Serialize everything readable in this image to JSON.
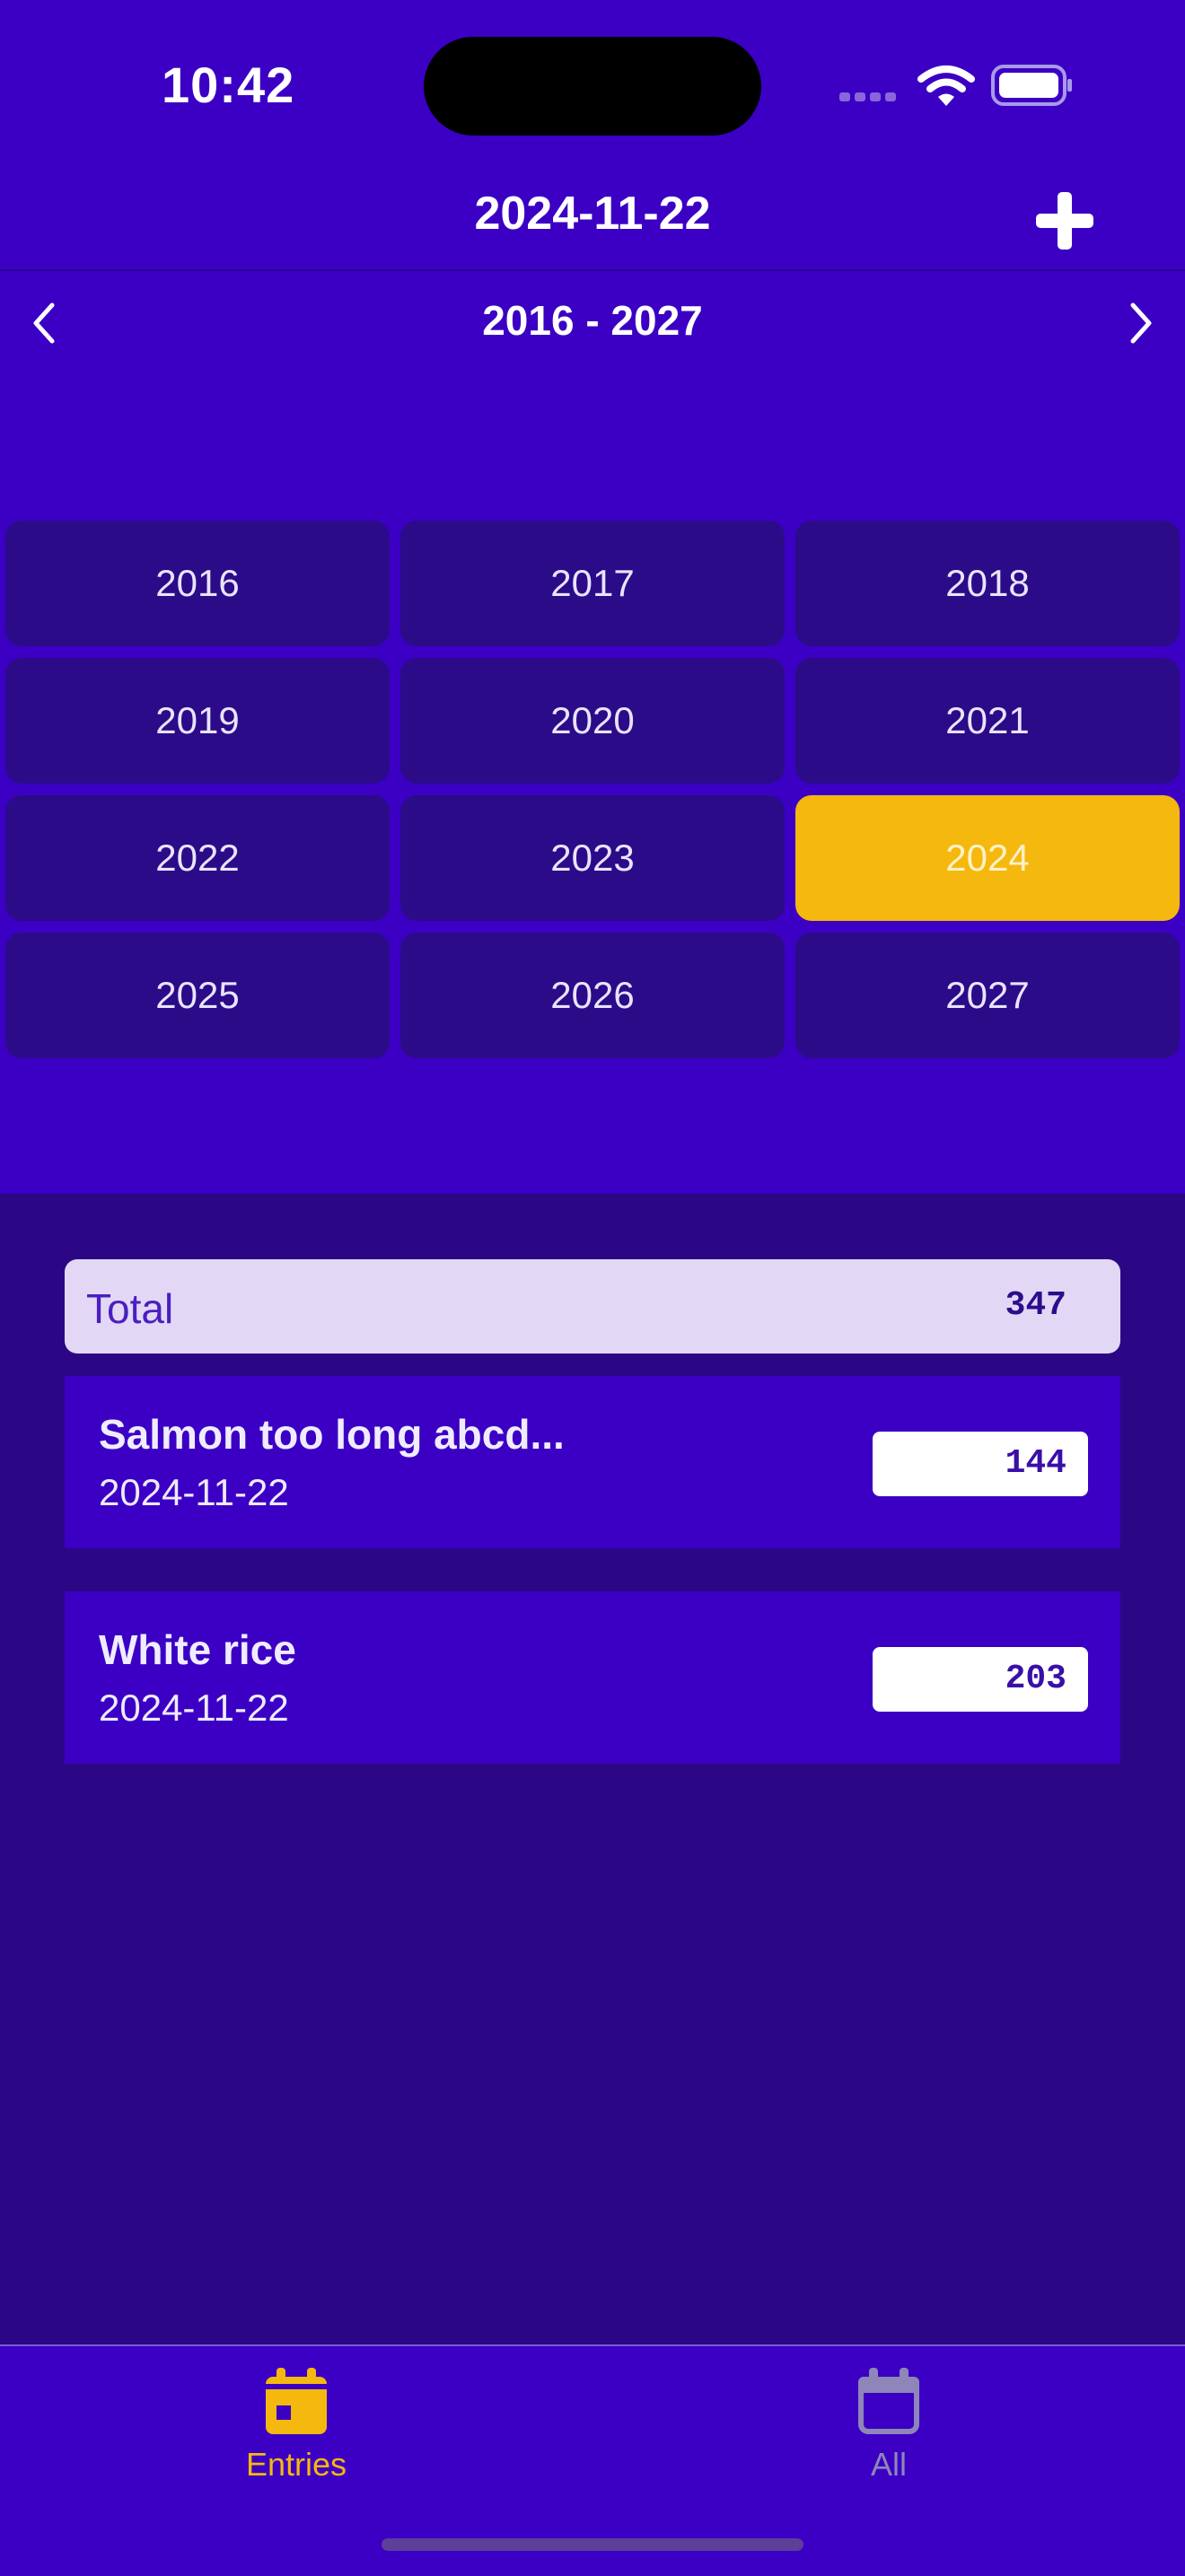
{
  "status_bar": {
    "time": "10:42",
    "icons": [
      "cellular-signal-icon",
      "wifi-icon",
      "battery-icon"
    ]
  },
  "header": {
    "title": "2024-11-22",
    "add_icon": "plus-icon"
  },
  "year_picker": {
    "range_label": "2016 - 2027",
    "prev_icon": "chevron-left-icon",
    "next_icon": "chevron-right-icon",
    "selected": "2024",
    "years": [
      "2016",
      "2017",
      "2018",
      "2019",
      "2020",
      "2021",
      "2022",
      "2023",
      "2024",
      "2025",
      "2026",
      "2027"
    ]
  },
  "summary": {
    "total_label": "Total",
    "total_value": "347"
  },
  "entries": [
    {
      "name": "Salmon too long abcd...",
      "date": "2024-11-22",
      "value": "144"
    },
    {
      "name": "White rice",
      "date": "2024-11-22",
      "value": "203"
    }
  ],
  "tab_bar": {
    "tabs": [
      {
        "label": "Entries",
        "icon": "calendar-icon",
        "active": true
      },
      {
        "label": "All",
        "icon": "calendar-icon",
        "active": false
      }
    ]
  },
  "colors": {
    "background": "#3b00c4",
    "list_background": "#2b0785",
    "accent": "#f5b80e",
    "total_row": "#e2d8f6"
  }
}
